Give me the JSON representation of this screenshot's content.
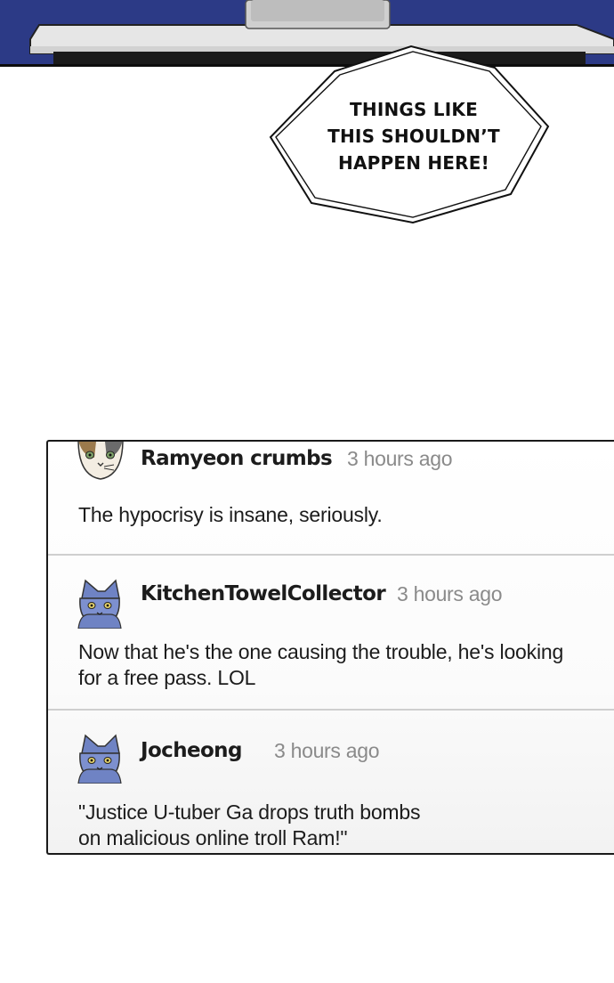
{
  "speech_bubble": {
    "lines": [
      "THINGS LIKE",
      "THIS SHOULDN’T",
      "HAPPEN HERE!"
    ]
  },
  "comments": [
    {
      "username": "Ramyeon crumbs",
      "time": "3 hours ago",
      "text_lines": [
        "The hypocrisy is insane, seriously."
      ],
      "avatar_icon": "calico-cat-avatar-icon"
    },
    {
      "username": "KitchenTowelCollector",
      "time": "3 hours ago",
      "text_lines": [
        "Now that he's the one causing the trouble, he's looking",
        "for a free pass. LOL"
      ],
      "avatar_icon": "blue-cat-avatar-icon"
    },
    {
      "username": "Jocheong",
      "time": "3 hours ago",
      "text_lines": [
        "\"Justice U-tuber Ga drops truth bombs",
        "on malicious online troll Ram!\""
      ],
      "avatar_icon": "blue-cat-avatar-icon"
    }
  ],
  "colors": {
    "scene_blue": "#2c3a86",
    "panel_border": "#1a1a1a",
    "timestamp_gray": "#8a8a8a",
    "avatar_blue": "#6f83c4"
  }
}
